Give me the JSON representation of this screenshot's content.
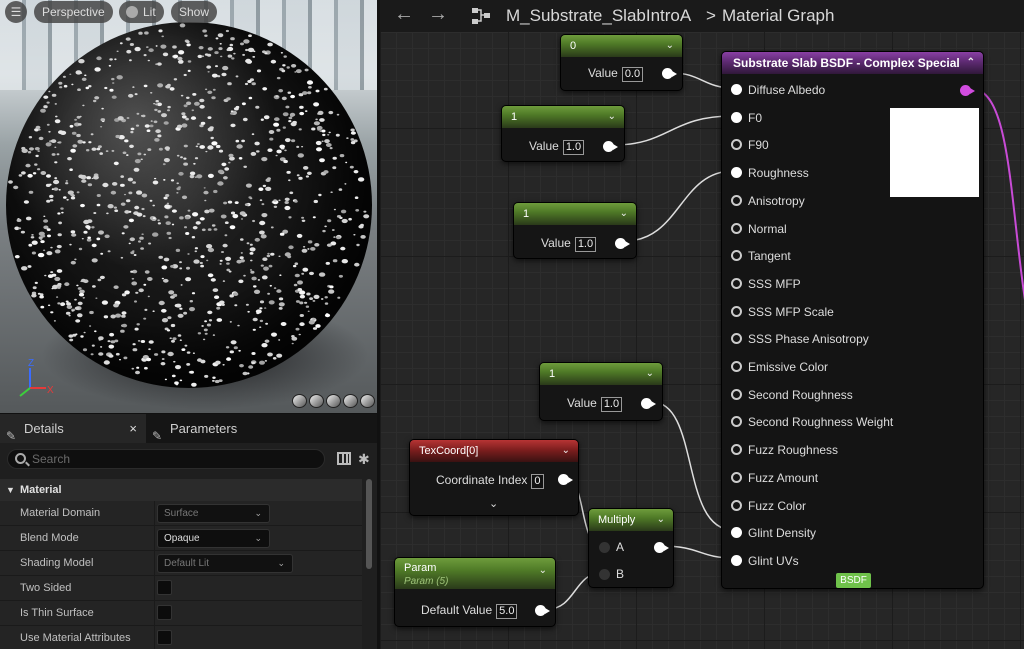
{
  "viewport": {
    "perspective_label": "Perspective",
    "lit_label": "Lit",
    "show_label": "Show",
    "axis_z": "Z",
    "axis_x": "X"
  },
  "details": {
    "tab_details": "Details",
    "tab_parameters": "Parameters",
    "close_glyph": "×",
    "search_placeholder": "Search",
    "section_title": "Material",
    "props": [
      {
        "label": "Material Domain",
        "value": "Surface"
      },
      {
        "label": "Blend Mode",
        "value": "Opaque"
      },
      {
        "label": "Shading Model",
        "value": "Default Lit"
      },
      {
        "label": "Two Sided",
        "value": ""
      },
      {
        "label": "Is Thin Surface",
        "value": ""
      },
      {
        "label": "Use Material Attributes",
        "value": ""
      }
    ]
  },
  "topbar": {
    "asset_name": "M_Substrate_SlabIntroA",
    "separator": ">",
    "graph_name": "Material Graph"
  },
  "nodes": {
    "const0": {
      "title": "0",
      "value_label": "Value",
      "value": "0.0"
    },
    "const1a": {
      "title": "1",
      "value_label": "Value",
      "value": "1.0"
    },
    "const1b": {
      "title": "1",
      "value_label": "Value",
      "value": "1.0"
    },
    "const1c": {
      "title": "1",
      "value_label": "Value",
      "value": "1.0"
    },
    "texcoord": {
      "title": "TexCoord[0]",
      "field_label": "Coordinate Index",
      "value": "0"
    },
    "multiply": {
      "title": "Multiply",
      "in_a": "A",
      "in_b": "B"
    },
    "param": {
      "title": "Param",
      "subtitle": "Param (5)",
      "field_label": "Default Value",
      "value": "5.0"
    },
    "bsdf": {
      "title": "Substrate Slab BSDF - Complex Special",
      "inputs": [
        "Diffuse Albedo",
        "F0",
        "F90",
        "Roughness",
        "Anisotropy",
        "Normal",
        "Tangent",
        "SSS MFP",
        "SSS MFP Scale",
        "SSS Phase Anisotropy",
        "Emissive Color",
        "Second Roughness",
        "Second Roughness Weight",
        "Fuzz Roughness",
        "Fuzz Amount",
        "Fuzz Color",
        "Glint Density",
        "Glint UVs"
      ],
      "tag": "BSDF"
    }
  },
  "colors": {
    "scalar_header": "#5a8a2e",
    "texcoord_header": "#a02a2a",
    "bsdf_header": "#7a3895",
    "bsdf_output_pin": "#d24ce0",
    "bsdf_tag": "#6fc24a"
  }
}
